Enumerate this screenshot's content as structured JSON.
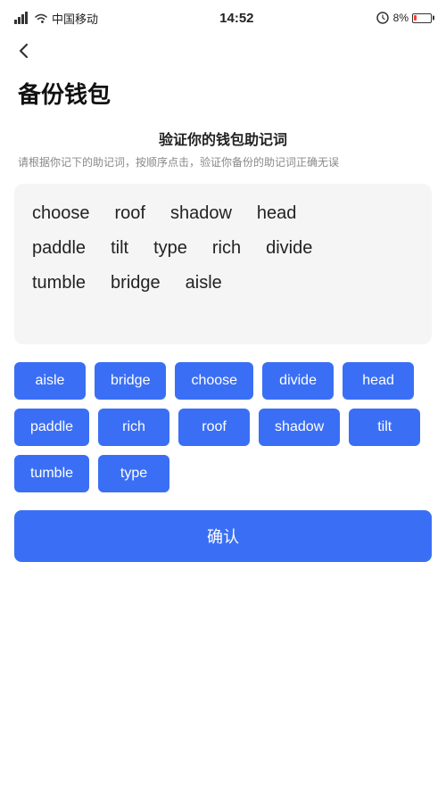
{
  "statusBar": {
    "carrier": "中国移动",
    "time": "14:52",
    "battery": "8%"
  },
  "backButton": "‹",
  "pageTitle": "备份钱包",
  "sectionHeading": "验证你的钱包助记词",
  "sectionDesc": "请根据你记下的助记词，按顺序点击，验证你备份的助记词正确无误",
  "displayWords": [
    [
      "choose",
      "roof",
      "shadow",
      "head"
    ],
    [
      "paddle",
      "tilt",
      "type",
      "rich",
      "divide"
    ],
    [
      "tumble",
      "bridge",
      "aisle"
    ]
  ],
  "wordButtons": [
    "aisle",
    "bridge",
    "choose",
    "divide",
    "head",
    "paddle",
    "rich",
    "roof",
    "shadow",
    "tilt",
    "tumble",
    "type"
  ],
  "confirmLabel": "确认"
}
